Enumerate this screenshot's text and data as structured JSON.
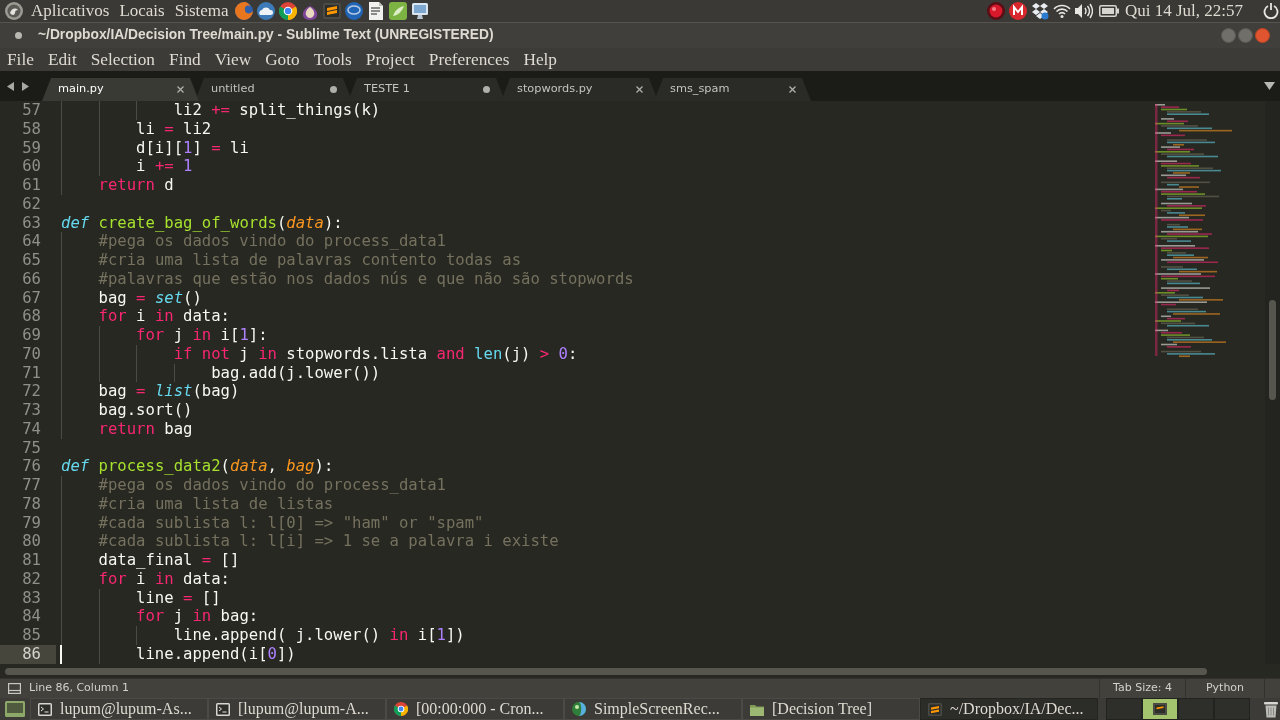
{
  "top_panel": {
    "menus": [
      "Aplicativos",
      "Locais",
      "Sistema"
    ],
    "clock": "Qui 14 Jul, 22:57"
  },
  "window": {
    "title": "~/Dropbox/IA/Decision Tree/main.py - Sublime Text (UNREGISTERED)"
  },
  "menu_bar": [
    "File",
    "Edit",
    "Selection",
    "Find",
    "View",
    "Goto",
    "Tools",
    "Project",
    "Preferences",
    "Help"
  ],
  "tabs": [
    {
      "label": "main.py",
      "selected": true,
      "modified": false
    },
    {
      "label": "untitled",
      "selected": false,
      "modified": true
    },
    {
      "label": "TESTE 1",
      "selected": false,
      "modified": true
    },
    {
      "label": "stopwords.py",
      "selected": false,
      "modified": false
    },
    {
      "label": "sms_spam",
      "selected": false,
      "modified": false
    }
  ],
  "editor": {
    "lines": [
      {
        "number": "57",
        "current": false,
        "tokens": [
          {
            "kind": "plain",
            "text": "            li2 "
          },
          {
            "kind": "operator",
            "text": "+="
          },
          {
            "kind": "plain",
            "text": " split_things(k)"
          }
        ]
      },
      {
        "number": "58",
        "current": false,
        "tokens": [
          {
            "kind": "plain",
            "text": "        li "
          },
          {
            "kind": "operator",
            "text": "="
          },
          {
            "kind": "plain",
            "text": " li2"
          }
        ]
      },
      {
        "number": "59",
        "current": false,
        "tokens": [
          {
            "kind": "plain",
            "text": "        d[i]["
          },
          {
            "kind": "number",
            "text": "1"
          },
          {
            "kind": "plain",
            "text": "] "
          },
          {
            "kind": "operator",
            "text": "="
          },
          {
            "kind": "plain",
            "text": " li"
          }
        ]
      },
      {
        "number": "60",
        "current": false,
        "tokens": [
          {
            "kind": "plain",
            "text": "        i "
          },
          {
            "kind": "operator",
            "text": "+="
          },
          {
            "kind": "number",
            "text": " 1"
          }
        ]
      },
      {
        "number": "61",
        "current": false,
        "tokens": [
          {
            "kind": "keyword",
            "text": "    return"
          },
          {
            "kind": "plain",
            "text": " d"
          }
        ]
      },
      {
        "number": "62",
        "current": false
      },
      {
        "number": "63",
        "current": false,
        "tokens": [
          {
            "kind": "storage",
            "text": "def"
          },
          {
            "kind": "function",
            "text": " create_bag_of_words"
          },
          {
            "kind": "plain",
            "text": "("
          },
          {
            "kind": "param",
            "text": "data"
          },
          {
            "kind": "plain",
            "text": "):"
          }
        ]
      },
      {
        "number": "64",
        "current": false,
        "tokens": [
          {
            "kind": "comment",
            "text": "    #pega os dados vindo do process_data1"
          }
        ]
      },
      {
        "number": "65",
        "current": false,
        "tokens": [
          {
            "kind": "comment",
            "text": "    #cria uma lista de palavras contento todas as"
          }
        ]
      },
      {
        "number": "66",
        "current": false,
        "tokens": [
          {
            "kind": "comment",
            "text": "    #palavras que estão nos dados nús e que não são stopwords"
          }
        ]
      },
      {
        "number": "67",
        "current": false,
        "tokens": [
          {
            "kind": "plain",
            "text": "    bag "
          },
          {
            "kind": "operator",
            "text": "="
          },
          {
            "kind": "type",
            "text": " set"
          },
          {
            "kind": "plain",
            "text": "()"
          }
        ]
      },
      {
        "number": "68",
        "current": false,
        "tokens": [
          {
            "kind": "keyword",
            "text": "    for"
          },
          {
            "kind": "plain",
            "text": " i "
          },
          {
            "kind": "keyword",
            "text": "in"
          },
          {
            "kind": "plain",
            "text": " data:"
          }
        ]
      },
      {
        "number": "69",
        "current": false,
        "tokens": [
          {
            "kind": "keyword",
            "text": "        for"
          },
          {
            "kind": "plain",
            "text": " j "
          },
          {
            "kind": "keyword",
            "text": "in"
          },
          {
            "kind": "plain",
            "text": " i["
          },
          {
            "kind": "number",
            "text": "1"
          },
          {
            "kind": "plain",
            "text": "]:"
          }
        ]
      },
      {
        "number": "70",
        "current": false,
        "tokens": [
          {
            "kind": "keyword",
            "text": "            if"
          },
          {
            "kind": "keyword",
            "text": " not"
          },
          {
            "kind": "plain",
            "text": " j "
          },
          {
            "kind": "keyword",
            "text": "in"
          },
          {
            "kind": "plain",
            "text": " stopwords.lista "
          },
          {
            "kind": "keyword",
            "text": "and"
          },
          {
            "kind": "builtin",
            "text": " len"
          },
          {
            "kind": "plain",
            "text": "(j) "
          },
          {
            "kind": "operator",
            "text": ">"
          },
          {
            "kind": "number",
            "text": " 0"
          },
          {
            "kind": "plain",
            "text": ":"
          }
        ]
      },
      {
        "number": "71",
        "current": false,
        "tokens": [
          {
            "kind": "plain",
            "text": "                bag.add(j.lower())"
          }
        ]
      },
      {
        "number": "72",
        "current": false,
        "tokens": [
          {
            "kind": "plain",
            "text": "    bag "
          },
          {
            "kind": "operator",
            "text": "="
          },
          {
            "kind": "type",
            "text": " list"
          },
          {
            "kind": "plain",
            "text": "(bag)"
          }
        ]
      },
      {
        "number": "73",
        "current": false,
        "tokens": [
          {
            "kind": "plain",
            "text": "    bag.sort()"
          }
        ]
      },
      {
        "number": "74",
        "current": false,
        "tokens": [
          {
            "kind": "keyword",
            "text": "    return"
          },
          {
            "kind": "plain",
            "text": " bag"
          }
        ]
      },
      {
        "number": "75",
        "current": false
      },
      {
        "number": "76",
        "current": false,
        "tokens": [
          {
            "kind": "storage",
            "text": "def"
          },
          {
            "kind": "function",
            "text": " process_data2"
          },
          {
            "kind": "plain",
            "text": "("
          },
          {
            "kind": "param",
            "text": "data"
          },
          {
            "kind": "plain",
            "text": ", "
          },
          {
            "kind": "param",
            "text": "bag"
          },
          {
            "kind": "plain",
            "text": "):"
          }
        ]
      },
      {
        "number": "77",
        "current": false,
        "tokens": [
          {
            "kind": "comment",
            "text": "    #pega os dados vindo do process_data1"
          }
        ]
      },
      {
        "number": "78",
        "current": false,
        "tokens": [
          {
            "kind": "comment",
            "text": "    #cria uma lista de listas"
          }
        ]
      },
      {
        "number": "79",
        "current": false,
        "tokens": [
          {
            "kind": "comment",
            "text": "    #cada sublista l: l[0] => \"ham\" or \"spam\""
          }
        ]
      },
      {
        "number": "80",
        "current": false,
        "tokens": [
          {
            "kind": "comment",
            "text": "    #cada sublista l: l[i] => 1 se a palavra i existe"
          }
        ]
      },
      {
        "number": "81",
        "current": false,
        "tokens": [
          {
            "kind": "plain",
            "text": "    data_final "
          },
          {
            "kind": "operator",
            "text": "="
          },
          {
            "kind": "plain",
            "text": " []"
          }
        ]
      },
      {
        "number": "82",
        "current": false,
        "tokens": [
          {
            "kind": "keyword",
            "text": "    for"
          },
          {
            "kind": "plain",
            "text": " i "
          },
          {
            "kind": "keyword",
            "text": "in"
          },
          {
            "kind": "plain",
            "text": " data:"
          }
        ]
      },
      {
        "number": "83",
        "current": false,
        "tokens": [
          {
            "kind": "plain",
            "text": "        line "
          },
          {
            "kind": "operator",
            "text": "="
          },
          {
            "kind": "plain",
            "text": " []"
          }
        ]
      },
      {
        "number": "84",
        "current": false,
        "tokens": [
          {
            "kind": "keyword",
            "text": "        for"
          },
          {
            "kind": "plain",
            "text": " j "
          },
          {
            "kind": "keyword",
            "text": "in"
          },
          {
            "kind": "plain",
            "text": " bag:"
          }
        ]
      },
      {
        "number": "85",
        "current": false,
        "tokens": [
          {
            "kind": "plain",
            "text": "            line.append( j.lower() "
          },
          {
            "kind": "keyword",
            "text": "in"
          },
          {
            "kind": "plain",
            "text": " i["
          },
          {
            "kind": "number",
            "text": "1"
          },
          {
            "kind": "plain",
            "text": "])"
          }
        ]
      },
      {
        "number": "86",
        "current": true,
        "tokens": [
          {
            "kind": "plain",
            "text": "        line.append(i["
          },
          {
            "kind": "number",
            "text": "0"
          },
          {
            "kind": "plain",
            "text": "])"
          }
        ]
      }
    ]
  },
  "status_bar": {
    "position": "Line 86, Column 1",
    "tab_size": "Tab Size: 4",
    "syntax": "Python"
  },
  "taskbar": [
    {
      "kind": "terminal",
      "label": "lupum@lupum-As...",
      "selected": false
    },
    {
      "kind": "terminal",
      "label": "[lupum@lupum-A...",
      "selected": false
    },
    {
      "kind": "browser",
      "label": "[00:00:000 - Cron...",
      "selected": false
    },
    {
      "kind": "recorder",
      "label": "SimpleScreenRec...",
      "selected": false
    },
    {
      "kind": "folder",
      "label": "[Decision Tree]",
      "selected": false
    },
    {
      "kind": "editor",
      "label": "~/Dropbox/IA/Dec...",
      "selected": true
    }
  ],
  "workspaces": [
    {
      "selected": false
    },
    {
      "selected": true
    },
    {
      "selected": false
    },
    {
      "selected": false
    }
  ]
}
